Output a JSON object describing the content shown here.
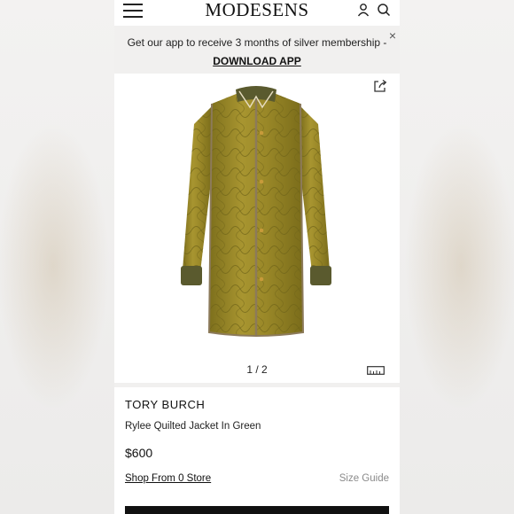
{
  "header": {
    "logo_text": "MODESENS"
  },
  "banner": {
    "text": "Get our app to receive 3 months of silver membership -",
    "link_text": "DOWNLOAD APP",
    "close_symbol": "×"
  },
  "gallery": {
    "counter": "1 / 2",
    "image_alt": "Tory Burch Rylee Quilted Jacket In Green"
  },
  "product": {
    "brand": "TORY BURCH",
    "name": "Rylee Quilted Jacket In Green",
    "price": "$600",
    "shop_link": "Shop From 0 Store",
    "size_guide": "Size Guide"
  },
  "icons": {
    "menu": "hamburger-menu-icon",
    "account": "user-icon",
    "search": "search-icon",
    "share": "share-icon",
    "size": "ruler-icon"
  },
  "colors": {
    "jacket": "#9a8a2a",
    "rib_trim": "#5a5a2e",
    "text": "#111111",
    "muted": "#8a8a8a"
  }
}
